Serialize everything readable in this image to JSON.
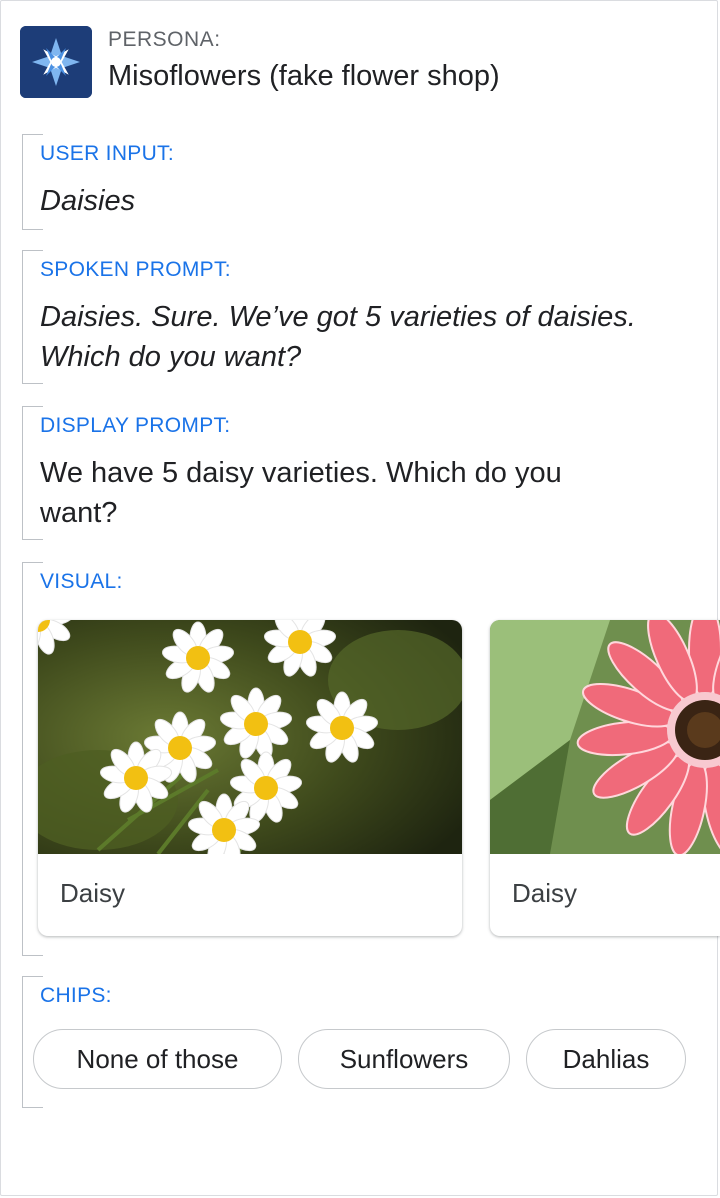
{
  "persona": {
    "label": "PERSONA:",
    "name": "Misoflowers (fake flower shop)",
    "icon": "miso-logo-icon",
    "icon_color": "#1d3d78"
  },
  "user_input": {
    "title": "USER INPUT:",
    "text": "Daisies"
  },
  "spoken_prompt": {
    "title": "SPOKEN PROMPT:",
    "text": "Daisies. Sure. We’ve got 5 varieties of daisies. Which do you want?"
  },
  "display_prompt": {
    "title": "DISPLAY PROMPT:",
    "text": "We have 5 daisy varieties. Which do you want?"
  },
  "visual": {
    "title": "VISUAL:",
    "cards": [
      {
        "caption": "Daisy",
        "image": "white-daisies-photo"
      },
      {
        "caption": "Daisy",
        "image": "pink-gerbera-daisy-photo"
      }
    ]
  },
  "chips": {
    "title": "CHIPS:",
    "items": [
      "None of those",
      "Sunflowers",
      "Dahlias"
    ]
  },
  "colors": {
    "section_title": "#1a73e8",
    "text": "#202124"
  }
}
